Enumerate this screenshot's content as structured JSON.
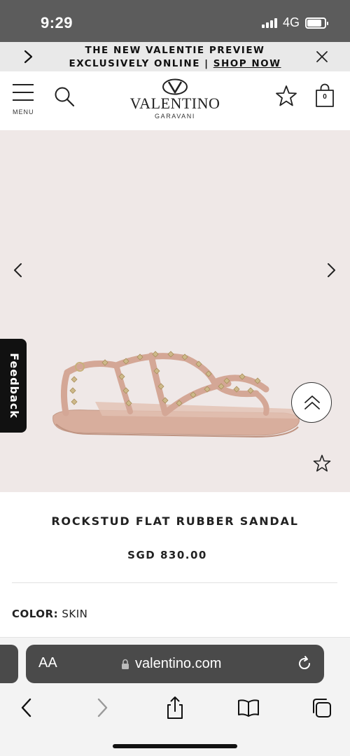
{
  "status_bar": {
    "time": "9:29",
    "network": "4G",
    "battery_level": 0.85
  },
  "promo": {
    "text": "THE NEW VALENTIE PREVIEW EXCLUSIVELY ONLINE | ",
    "link_label": "SHOP NOW"
  },
  "header": {
    "menu_label": "MENU",
    "brand_name": "VALENTINO",
    "brand_sub": "GARAVANI",
    "bag_count": "0"
  },
  "gallery": {
    "feedback_label": "Feedback"
  },
  "product": {
    "title": "ROCKSTUD FLAT RUBBER SANDAL",
    "price": "SGD 830.00",
    "color_label": "COLOR:",
    "color_value": "SKIN"
  },
  "browser": {
    "aa_label": "AA",
    "url": "valentino.com"
  },
  "colors": {
    "status_bar_bg": "#5c5c5c",
    "promo_bg": "#e9e9e9",
    "gallery_bg": "#efe8e7",
    "sandal": "#d6aa98",
    "stud": "#cdb98a",
    "address_bar_bg": "#4a4a4a"
  },
  "icons": [
    "chevron-right-icon",
    "close-icon",
    "hamburger-icon",
    "search-icon",
    "valentino-logo",
    "star-icon",
    "shopping-bag-icon",
    "chevron-left-icon",
    "double-chevron-up-icon",
    "lock-icon",
    "reload-icon",
    "share-icon",
    "book-icon",
    "tabs-icon"
  ]
}
